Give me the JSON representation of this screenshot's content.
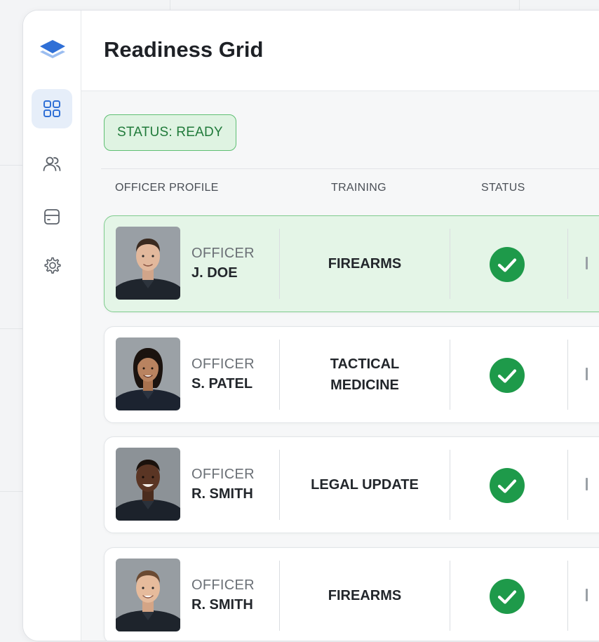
{
  "header": {
    "title": "Readiness Grid"
  },
  "status_badge": {
    "label": "STATUS: READY"
  },
  "table": {
    "columns": [
      "OFFICER PROFILE",
      "TRAINING",
      "STATUS"
    ],
    "rows": [
      {
        "rank": "OFFICER",
        "name": "J. DOE",
        "training": "FIREARMS",
        "status": "check-circle-icon",
        "selected": true
      },
      {
        "rank": "OFFICER",
        "name": "S. PATEL",
        "training": "TACTICAL MEDICINE",
        "status": "check-circle-icon",
        "selected": false
      },
      {
        "rank": "OFFICER",
        "name": "R. SMITH",
        "training": "LEGAL UPDATE",
        "status": "check-circle-icon",
        "selected": false
      },
      {
        "rank": "OFFICER",
        "name": "R. SMITH",
        "training": "FIREARMS",
        "status": "check-circle-icon",
        "selected": false
      }
    ]
  },
  "sidebar": {
    "items": [
      {
        "icon": "dashboard-grid-icon",
        "active": true
      },
      {
        "icon": "users-icon",
        "active": false
      },
      {
        "icon": "archive-icon",
        "active": false
      },
      {
        "icon": "gear-icon",
        "active": false
      }
    ]
  },
  "colors": {
    "accent_green": "#1e9a4a",
    "selected_row_bg": "#e4f5e7",
    "badge_bg": "#dff3e2",
    "active_nav_bg": "#e6eef9",
    "brand_blue": "#2f6fd6"
  }
}
